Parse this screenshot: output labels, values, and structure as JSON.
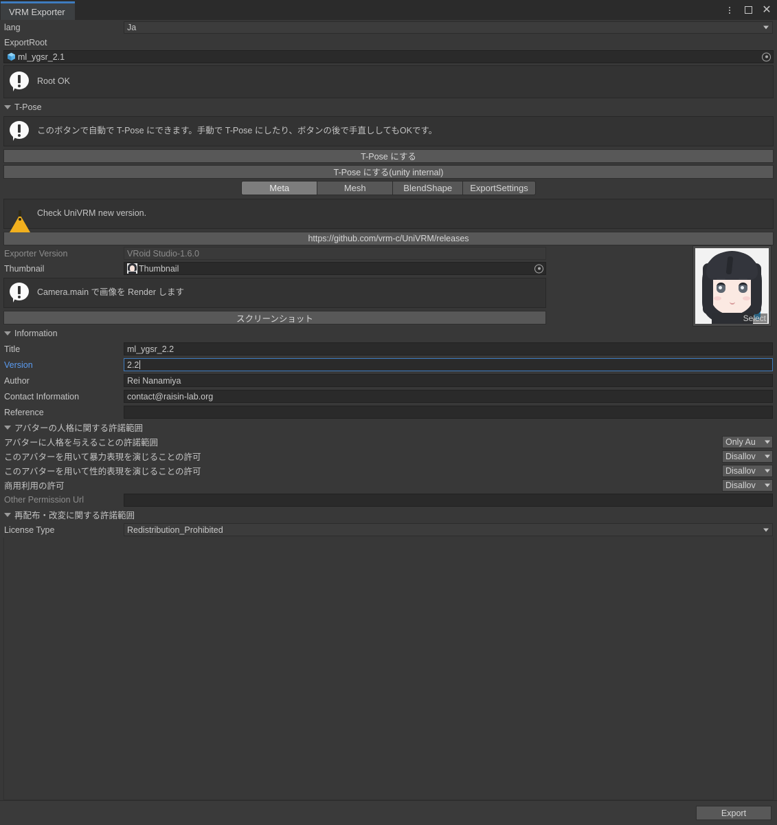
{
  "window": {
    "tab_title": "VRM Exporter",
    "menu_icon": "kebab-menu-icon",
    "maximize_icon": "maximize-icon",
    "close_icon": "close-icon",
    "close_glyph": "✕",
    "accent_color": "#3e7cc0"
  },
  "lang": {
    "label": "lang",
    "value": "Ja"
  },
  "export_root": {
    "label": "ExportRoot",
    "value": "ml_ygsr_2.1",
    "object_icon": "prefab-cube-icon",
    "picker_icon": "object-picker-icon"
  },
  "root_status": {
    "icon": "info-icon",
    "message": "Root OK"
  },
  "tpose": {
    "foldout_label": "T-Pose",
    "help_icon": "info-icon",
    "help_text": "このボタンで自動で T-Pose にできます。手動で T-Pose にしたり、ボタンの後で手直ししてもOKです。",
    "button_primary": "T-Pose にする",
    "button_secondary": "T-Pose にする(unity internal)"
  },
  "tabs": [
    {
      "label": "Meta",
      "active": true
    },
    {
      "label": "Mesh",
      "active": false
    },
    {
      "label": "BlendShape",
      "active": false
    },
    {
      "label": "ExportSettings",
      "active": false
    }
  ],
  "version_warning": {
    "icon": "warning-icon",
    "message": "Check UniVRM new version.",
    "link_button": "https://github.com/vrm-c/UniVRM/releases",
    "warning_color": "#f2b01e"
  },
  "exporter_version": {
    "label": "Exporter Version",
    "value": "VRoid Studio-1.6.0"
  },
  "thumbnail": {
    "label": "Thumbnail",
    "value": "Thumbnail",
    "preview_icon": "thumbnail-preview-icon",
    "picker_icon": "object-picker-icon",
    "select_label": "Select",
    "avatar_icon": "avatar-portrait-image"
  },
  "render_hint": {
    "icon": "info-icon",
    "message": "Camera.main で画像を Render します",
    "button": "スクリーンショット"
  },
  "information": {
    "foldout_label": "Information",
    "fields": [
      {
        "label": "Title",
        "value": "ml_ygsr_2.2",
        "focused": false
      },
      {
        "label": "Version",
        "value": "2.2",
        "focused": true
      },
      {
        "label": "Author",
        "value": "Rei Nanamiya",
        "focused": false
      },
      {
        "label": "Contact Information",
        "value": "contact@raisin-lab.org",
        "focused": false
      },
      {
        "label": "Reference",
        "value": "",
        "focused": false
      }
    ],
    "focus_label_color": "#5a9bf0"
  },
  "personation": {
    "foldout_label": "アバターの人格に関する許諾範囲",
    "rows": [
      {
        "label": "アバターに人格を与えることの許諾範囲",
        "value": "Only Au"
      },
      {
        "label": "このアバターを用いて暴力表現を演じることの許可",
        "value": "Disallov"
      },
      {
        "label": "このアバターを用いて性的表現を演じることの許可",
        "value": "Disallov"
      },
      {
        "label": "商用利用の許可",
        "value": "Disallov"
      }
    ],
    "other_url": {
      "label": "Other Permission Url",
      "value": ""
    }
  },
  "redistribution": {
    "foldout_label": "再配布・改変に関する許諾範囲",
    "license_type": {
      "label": "License Type",
      "value": "Redistribution_Prohibited"
    }
  },
  "footer": {
    "export_button": "Export"
  }
}
